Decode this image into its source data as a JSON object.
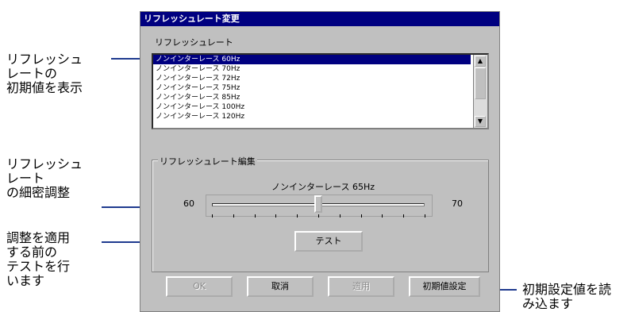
{
  "annotations": {
    "initial_display": "リフレッシュ\nレートの\n初期値を表示",
    "fine_adjust": "リフレッシュ\nレート\nの細密調整",
    "test_before_apply": "調整を適用\nする前の\nテストを行\nいます",
    "load_defaults": "初期設定値を読\nみ込ます"
  },
  "dialog": {
    "title": "リフレッシュレート変更",
    "list_label": "リフレッシュレート",
    "list_items": [
      "ノンインターレース 60Hz",
      "ノンインターレース 70Hz",
      "ノンインターレース 72Hz",
      "ノンインターレース 75Hz",
      "ノンインターレース 85Hz",
      "ノンインターレース 100Hz",
      "ノンインターレース 120Hz"
    ],
    "selected_index": 0,
    "group_label": "リフレッシュレート編集",
    "slider_caption": "ノンインターレース 65Hz",
    "slider_min_label": "60",
    "slider_max_label": "70",
    "slider_value_fraction": 0.5,
    "test_button": "テスト",
    "buttons": {
      "ok": "OK",
      "cancel": "取消",
      "apply": "適用",
      "defaults": "初期値設定"
    }
  }
}
